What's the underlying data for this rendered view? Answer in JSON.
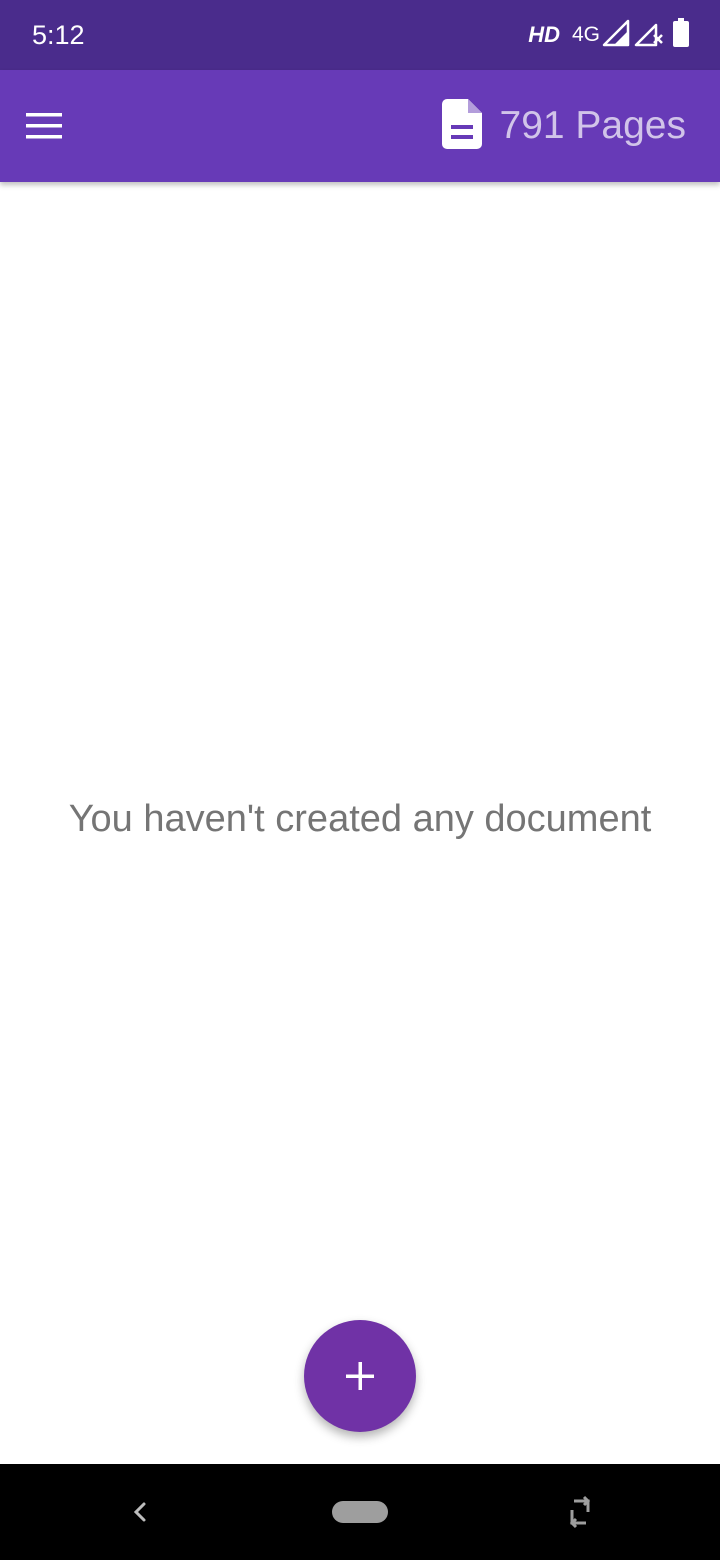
{
  "status_bar": {
    "time": "5:12",
    "hd": "HD",
    "network": "4G",
    "icons": [
      "signal-icon",
      "signal-no-data-icon",
      "battery-icon"
    ]
  },
  "app_bar": {
    "menu_icon": "menu-icon",
    "pages_icon": "document-icon",
    "page_count": "791 Pages",
    "background_color": "#673ab7",
    "page_count_color": "#d1c4e9"
  },
  "main": {
    "empty_message": "You haven't created any document"
  },
  "fab": {
    "icon": "plus-icon",
    "color": "#7032a6"
  },
  "nav_bar": {
    "icons": [
      "back-icon",
      "home-pill",
      "rotate-icon"
    ]
  }
}
